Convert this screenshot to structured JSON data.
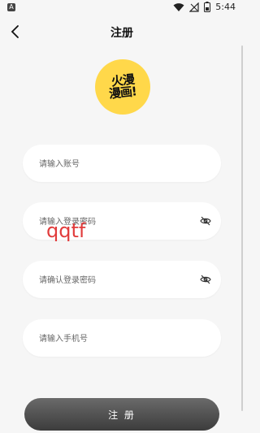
{
  "status_bar": {
    "time": "5:44",
    "icons": [
      "notification-icon",
      "wifi-icon",
      "signal-icon",
      "battery-icon"
    ]
  },
  "header": {
    "title": "注册",
    "back_icon": "chevron-left-icon"
  },
  "logo": {
    "line1": "火漫",
    "line2": "漫画!",
    "color": "#ffd84a"
  },
  "form": {
    "account_placeholder": "请输入账号",
    "password_placeholder": "请输入登录密码",
    "confirm_password_placeholder": "请确认登录密码",
    "phone_placeholder": "请输入手机号",
    "visibility_icon": "eye-off-icon"
  },
  "watermark": "qqtf",
  "submit_label": "注 册"
}
